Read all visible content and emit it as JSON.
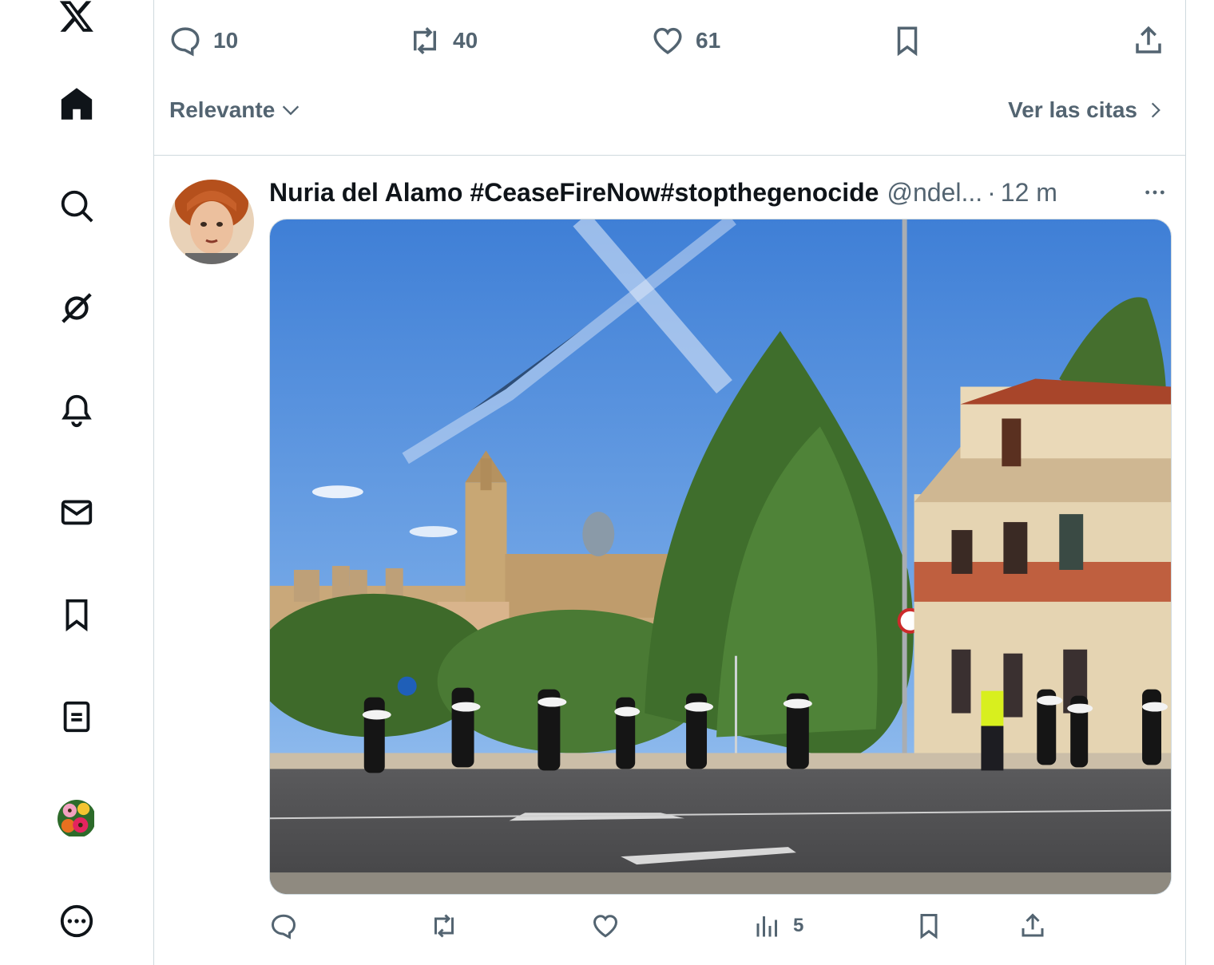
{
  "colors": {
    "text": "#0f1419",
    "secondary": "#536471",
    "border": "#cfd9de"
  },
  "nav": {
    "items": [
      {
        "name": "x-logo-icon"
      },
      {
        "name": "home-icon"
      },
      {
        "name": "search-icon"
      },
      {
        "name": "grok-icon"
      },
      {
        "name": "notifications-bell-icon"
      },
      {
        "name": "messages-envelope-icon"
      },
      {
        "name": "bookmarks-icon"
      },
      {
        "name": "lists-icon"
      },
      {
        "name": "profile-avatar"
      },
      {
        "name": "more-circle-icon"
      }
    ]
  },
  "main_post_actions": {
    "replies": "10",
    "reposts": "40",
    "likes": "61"
  },
  "replies_filter": {
    "sort_label": "Relevante",
    "quotes_link": "Ver las citas"
  },
  "reply_tweet": {
    "display_name": "Nuria del Alamo #CeaseFireNow#stopthegenocide",
    "handle": "@ndel...",
    "separator": "·",
    "time": "12 m",
    "views": "5"
  }
}
